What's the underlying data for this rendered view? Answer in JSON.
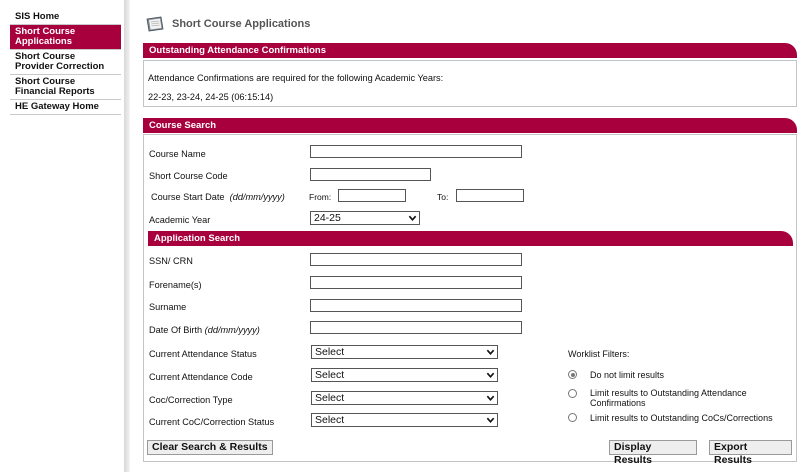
{
  "sidebar": {
    "items": [
      {
        "label": "SIS Home",
        "active": false
      },
      {
        "label": "Short Course Applications",
        "active": true
      },
      {
        "label": "Short Course Provider Correction",
        "active": false
      },
      {
        "label": "Short Course Financial Reports",
        "active": false
      },
      {
        "label": "HE Gateway Home",
        "active": false
      }
    ]
  },
  "header": {
    "title": "Short Course Applications"
  },
  "outstanding": {
    "title": "Outstanding Attendance Confirmations",
    "message": "Attendance Confirmations are required for the following Academic Years:",
    "years": "22-23, 23-24, 24-25 (06:15:14)"
  },
  "course_search": {
    "title": "Course Search",
    "course_name_label": "Course Name",
    "course_name_value": "",
    "short_code_label": "Short Course Code",
    "short_code_value": "",
    "start_date_label": "Course Start Date",
    "start_date_hint": "(dd/mm/yyyy)",
    "from_label": "From:",
    "to_label": "To:",
    "academic_year_label": "Academic Year",
    "academic_year_value": "24-25"
  },
  "application_search": {
    "title": "Application Search",
    "ssn_label": "SSN/ CRN",
    "forenames_label": "Forename(s)",
    "surname_label": "Surname",
    "dob_label": "Date Of Birth",
    "dob_hint": "(dd/mm/yyyy)",
    "att_status_label": "Current Attendance Status",
    "att_code_label": "Current Attendance Code",
    "coc_type_label": "Coc/Correction Type",
    "coc_status_label": "Current CoC/Correction Status",
    "select_default": "Select"
  },
  "worklist": {
    "label": "Worklist Filters:",
    "options": [
      {
        "label": "Do not limit results",
        "checked": true
      },
      {
        "label": "Limit results to Outstanding Attendance Confirmations",
        "checked": false
      },
      {
        "label": "Limit results to Outstanding CoCs/Corrections",
        "checked": false
      }
    ]
  },
  "buttons": {
    "clear": "Clear Search & Results",
    "display": "Display Results",
    "export": "Export Results"
  },
  "colors": {
    "accent": "#a8003c"
  }
}
